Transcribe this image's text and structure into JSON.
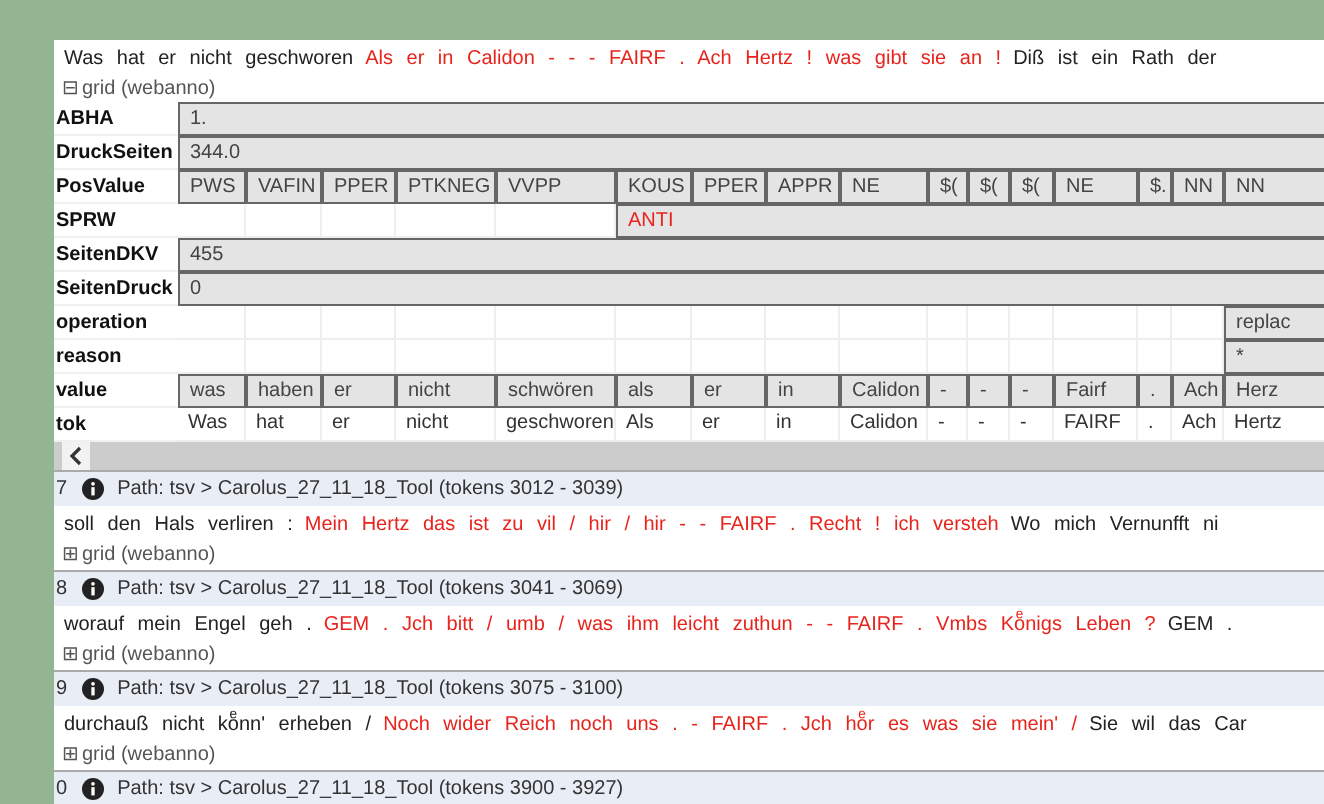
{
  "sentence": [
    {
      "text": "Was hat er nicht geschworen",
      "highlighted": false
    },
    {
      "text": "Als er in Calidon - - - FAIRF . Ach Hertz ! was gibt sie an !",
      "highlighted": true
    },
    {
      "text": "Diß ist ein Rath der",
      "highlighted": false
    }
  ],
  "grid": {
    "toggle": "⊟",
    "label": "grid (webanno)",
    "rows": [
      {
        "label": "ABHA",
        "cells": [
          {
            "text": "1.",
            "kind": "annotation",
            "highlighted": false
          }
        ]
      },
      {
        "label": "DruckSeiten",
        "cells": [
          {
            "text": "344.0",
            "kind": "annotation",
            "highlighted": false
          }
        ]
      },
      {
        "label": "PosValue",
        "cells": [
          {
            "text": "PWS",
            "kind": "annotation",
            "highlighted": false
          },
          {
            "text": "VAFIN",
            "kind": "annotation",
            "highlighted": false
          },
          {
            "text": "PPER",
            "kind": "annotation",
            "highlighted": false
          },
          {
            "text": "PTKNEG",
            "kind": "annotation",
            "highlighted": false
          },
          {
            "text": "VVPP",
            "kind": "annotation",
            "highlighted": false
          },
          {
            "text": "KOUS",
            "kind": "annotation",
            "highlighted": false
          },
          {
            "text": "PPER",
            "kind": "annotation",
            "highlighted": false
          },
          {
            "text": "APPR",
            "kind": "annotation",
            "highlighted": false
          },
          {
            "text": "NE",
            "kind": "annotation",
            "highlighted": false
          },
          {
            "text": "$(",
            "kind": "annotation",
            "highlighted": false
          },
          {
            "text": "$(",
            "kind": "annotation",
            "highlighted": false
          },
          {
            "text": "$(",
            "kind": "annotation",
            "highlighted": false
          },
          {
            "text": "NE",
            "kind": "annotation",
            "highlighted": false
          },
          {
            "text": "$.",
            "kind": "annotation",
            "highlighted": false
          },
          {
            "text": "NN",
            "kind": "annotation",
            "highlighted": false
          },
          {
            "text": "NN",
            "kind": "annotation",
            "highlighted": false
          }
        ]
      },
      {
        "label": "SPRW",
        "cells": [
          {
            "kind": "blank"
          },
          {
            "kind": "blank"
          },
          {
            "kind": "blank"
          },
          {
            "kind": "blank"
          },
          {
            "kind": "blank"
          },
          {
            "text": "ANTI",
            "kind": "annotation",
            "highlighted": true
          }
        ]
      },
      {
        "label": "SeitenDKV",
        "cells": [
          {
            "text": "455",
            "kind": "annotation",
            "highlighted": false
          }
        ]
      },
      {
        "label": "SeitenDruck",
        "cells": [
          {
            "text": "0",
            "kind": "annotation",
            "highlighted": false
          }
        ]
      },
      {
        "label": "operation",
        "cells": [
          {
            "kind": "blank"
          },
          {
            "kind": "blank"
          },
          {
            "kind": "blank"
          },
          {
            "kind": "blank"
          },
          {
            "kind": "blank"
          },
          {
            "kind": "blank"
          },
          {
            "kind": "blank"
          },
          {
            "kind": "blank"
          },
          {
            "kind": "blank"
          },
          {
            "kind": "blank"
          },
          {
            "kind": "blank"
          },
          {
            "kind": "blank"
          },
          {
            "kind": "blank"
          },
          {
            "kind": "blank"
          },
          {
            "kind": "blank"
          },
          {
            "text": "replac",
            "kind": "annotation",
            "highlighted": false
          }
        ]
      },
      {
        "label": "reason",
        "cells": [
          {
            "kind": "blank"
          },
          {
            "kind": "blank"
          },
          {
            "kind": "blank"
          },
          {
            "kind": "blank"
          },
          {
            "kind": "blank"
          },
          {
            "kind": "blank"
          },
          {
            "kind": "blank"
          },
          {
            "kind": "blank"
          },
          {
            "kind": "blank"
          },
          {
            "kind": "blank"
          },
          {
            "kind": "blank"
          },
          {
            "kind": "blank"
          },
          {
            "kind": "blank"
          },
          {
            "kind": "blank"
          },
          {
            "kind": "blank"
          },
          {
            "text": "*",
            "kind": "annotation",
            "highlighted": false
          }
        ]
      },
      {
        "label": "value",
        "cells": [
          {
            "text": "was",
            "kind": "annotation",
            "highlighted": false
          },
          {
            "text": "haben",
            "kind": "annotation",
            "highlighted": false
          },
          {
            "text": "er",
            "kind": "annotation",
            "highlighted": false
          },
          {
            "text": "nicht",
            "kind": "annotation",
            "highlighted": false
          },
          {
            "text": "schwören",
            "kind": "annotation",
            "highlighted": false
          },
          {
            "text": "als",
            "kind": "annotation",
            "highlighted": false
          },
          {
            "text": "er",
            "kind": "annotation",
            "highlighted": false
          },
          {
            "text": "in",
            "kind": "annotation",
            "highlighted": false
          },
          {
            "text": "Calidon",
            "kind": "annotation",
            "highlighted": false
          },
          {
            "text": "-",
            "kind": "annotation",
            "highlighted": false
          },
          {
            "text": "-",
            "kind": "annotation",
            "highlighted": false
          },
          {
            "text": "-",
            "kind": "annotation",
            "highlighted": false
          },
          {
            "text": "Fairf",
            "kind": "annotation",
            "highlighted": false
          },
          {
            "text": ".",
            "kind": "annotation",
            "highlighted": false
          },
          {
            "text": "Ach",
            "kind": "annotation",
            "highlighted": false
          },
          {
            "text": "Herz",
            "kind": "annotation",
            "highlighted": false
          }
        ]
      },
      {
        "label": "tok",
        "cells": [
          {
            "text": "Was",
            "kind": "token"
          },
          {
            "text": "hat",
            "kind": "token"
          },
          {
            "text": "er",
            "kind": "token"
          },
          {
            "text": "nicht",
            "kind": "token"
          },
          {
            "text": "geschworen",
            "kind": "token"
          },
          {
            "text": "Als",
            "kind": "token"
          },
          {
            "text": "er",
            "kind": "token"
          },
          {
            "text": "in",
            "kind": "token"
          },
          {
            "text": "Calidon",
            "kind": "token"
          },
          {
            "text": "-",
            "kind": "token"
          },
          {
            "text": "-",
            "kind": "token"
          },
          {
            "text": "-",
            "kind": "token"
          },
          {
            "text": "FAIRF",
            "kind": "token"
          },
          {
            "text": ".",
            "kind": "token"
          },
          {
            "text": "Ach",
            "kind": "token"
          },
          {
            "text": "Hertz",
            "kind": "token"
          }
        ]
      }
    ]
  },
  "sections": [
    {
      "number": "7",
      "path": "Path: tsv > Carolus_27_11_18_Tool (tokens 3012 - 3039)",
      "sentence": [
        {
          "text": "soll den Hals verliren :",
          "highlighted": false
        },
        {
          "text": "Mein Hertz das ist zu vil / hir / hir - - FAIRF . Recht ! ich versteh",
          "highlighted": true
        },
        {
          "text": "Wo mich Vernunfft ni",
          "highlighted": false
        }
      ],
      "toggle": "⊞",
      "grid_label": "grid (webanno)"
    },
    {
      "number": "8",
      "path": "Path: tsv > Carolus_27_11_18_Tool (tokens 3041 - 3069)",
      "sentence": [
        {
          "text": "worauf mein Engel geh .",
          "highlighted": false
        },
        {
          "text": "GEM . Jch bitt / umb / was ihm leicht zuthun - - FAIRF . Vmbs Koͤnigs Leben ?",
          "highlighted": true
        },
        {
          "text": "GEM .",
          "highlighted": false
        }
      ],
      "toggle": "⊞",
      "grid_label": "grid (webanno)"
    },
    {
      "number": "9",
      "path": "Path: tsv > Carolus_27_11_18_Tool (tokens 3075 - 3100)",
      "sentence": [
        {
          "text": "durchauß nicht koͤnn' erheben /",
          "highlighted": false
        },
        {
          "text": "Noch wider Reich noch uns . - FAIRF . Jch hoͤr es was sie mein' /",
          "highlighted": true
        },
        {
          "text": "Sie wil das Car",
          "highlighted": false
        }
      ],
      "toggle": "⊞",
      "grid_label": "grid (webanno)"
    },
    {
      "number": "0",
      "path": "Path: tsv > Carolus_27_11_18_Tool (tokens 3900 - 3927)"
    }
  ]
}
